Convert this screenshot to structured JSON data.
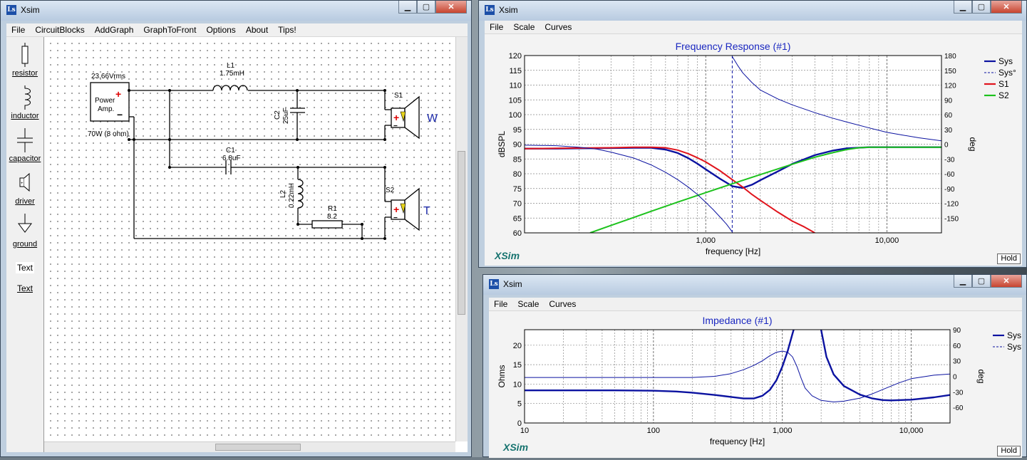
{
  "colors": {
    "sys": "#0b12a0",
    "s1": "#e0141c",
    "s2": "#1dc21d",
    "title": "#1a27c0",
    "xsim_logo": "#16736f"
  },
  "main_window": {
    "title": "Xsim",
    "menu": [
      "File",
      "CircuitBlocks",
      "AddGraph",
      "GraphToFront",
      "Options",
      "About",
      "Tips!"
    ],
    "palette": [
      {
        "label": "resistor",
        "icon": "resistor-icon"
      },
      {
        "label": "inductor",
        "icon": "inductor-icon"
      },
      {
        "label": "capacitor",
        "icon": "capacitor-icon"
      },
      {
        "label": "driver",
        "icon": "driver-icon"
      },
      {
        "label": "ground",
        "icon": "ground-icon"
      },
      {
        "label": "Text",
        "icon": "text-tool"
      },
      {
        "label": "Text",
        "icon": "text-tool"
      }
    ],
    "schematic": {
      "amp_voltage": "23.66Vrms",
      "amp_label_line1": "Power",
      "amp_label_line2": "Amp.",
      "amp_power": "70W (8 ohm)",
      "L1_name": "L1",
      "L1_value": "1.75mH",
      "C2_name": "C2",
      "C2_value": "25uF",
      "C1_name": "C1",
      "C1_value": "6.8uF",
      "L2_name": "L2",
      "L2_value": "0.22mH",
      "R1_name": "R1",
      "R1_value": "8.2",
      "S1_name": "S1",
      "S1_label": "W",
      "S2_name": "S2",
      "S2_label": "T"
    }
  },
  "freq_window": {
    "title": "Xsim",
    "menu": [
      "File",
      "Scale",
      "Curves"
    ],
    "hold": "Hold",
    "xsim_logo": "XSim"
  },
  "imp_window": {
    "title": "Xsim",
    "menu": [
      "File",
      "Scale",
      "Curves"
    ],
    "hold": "Hold",
    "xsim_logo": "XSim"
  },
  "chart_data": [
    {
      "type": "line",
      "title": "Frequency Response (#1)",
      "xlabel": "frequency [Hz]",
      "ylabel": "dBSPL",
      "y2label": "deg",
      "xscale": "log",
      "xlim": [
        100,
        20000
      ],
      "ylim": [
        60,
        120
      ],
      "y2lim": [
        -180,
        180
      ],
      "xticks": [
        {
          "v": 1000,
          "t": "1,000"
        },
        {
          "v": 10000,
          "t": "10,000"
        }
      ],
      "yticks": [
        60,
        65,
        70,
        75,
        80,
        85,
        90,
        95,
        100,
        105,
        110,
        115,
        120
      ],
      "y2ticks": [
        180,
        150,
        120,
        90,
        60,
        30,
        0,
        -30,
        -60,
        -90,
        -120,
        -150
      ],
      "grid": true,
      "legend": "top-right",
      "series": [
        {
          "name": "Sys",
          "axis": "y",
          "dash": false,
          "width": 2.4,
          "color": "#0b12a0",
          "x": [
            100,
            150,
            200,
            300,
            400,
            500,
            600,
            700,
            800,
            900,
            1000,
            1200,
            1400,
            1600,
            1800,
            2000,
            2500,
            3000,
            4000,
            5000,
            6000,
            8000,
            10000,
            12000,
            15000,
            20000
          ],
          "y": [
            88.5,
            88.5,
            88.6,
            88.7,
            88.8,
            88.8,
            88.2,
            87,
            85.3,
            83.4,
            81.5,
            78.3,
            75.8,
            75.2,
            76.3,
            77.8,
            80.8,
            83.3,
            86.3,
            87.8,
            88.6,
            89,
            89,
            89,
            89,
            89
          ]
        },
        {
          "name": "Sys°",
          "axis": "y2",
          "dash": true,
          "width": 1,
          "color": "#0b12a0",
          "x": [
            1400,
            1400
          ],
          "y": [
            -180,
            180
          ]
        },
        {
          "name": "S1",
          "axis": "y",
          "dash": false,
          "width": 2,
          "color": "#e0141c",
          "x": [
            100,
            150,
            200,
            300,
            400,
            500,
            600,
            700,
            800,
            900,
            1000,
            1200,
            1400,
            1600,
            1800,
            2000,
            2500,
            3000,
            3500,
            4000
          ],
          "y": [
            88.5,
            88.6,
            88.7,
            88.8,
            89,
            89,
            88.8,
            88,
            86.8,
            85.4,
            84,
            81,
            78,
            75.5,
            73,
            71,
            67,
            64,
            62,
            60
          ]
        },
        {
          "name": "S2",
          "axis": "y",
          "dash": false,
          "width": 2,
          "color": "#1dc21d",
          "x": [
            230,
            300,
            400,
            500,
            700,
            1000,
            1400,
            2000,
            3000,
            4000,
            5000,
            6000,
            7000,
            8000,
            10000,
            12000,
            15000,
            20000
          ],
          "y": [
            60,
            62.5,
            65.2,
            67.3,
            70.4,
            73.6,
            76.6,
            79.7,
            83.2,
            85.6,
            87.1,
            88.2,
            88.8,
            89,
            89,
            89,
            89,
            89
          ]
        },
        {
          "name": "",
          "axis": "y2",
          "dash": false,
          "width": 1,
          "color": "#0b12a0",
          "x": [
            100,
            150,
            200,
            250,
            300,
            400,
            500,
            600,
            700,
            800,
            900,
            1000,
            1100,
            1200,
            1300,
            1400
          ],
          "y": [
            -2,
            -3,
            -6,
            -10,
            -16,
            -28,
            -42,
            -57,
            -72,
            -87,
            -102,
            -118,
            -133,
            -148,
            -162,
            -178
          ]
        },
        {
          "name": "",
          "axis": "y2",
          "dash": false,
          "width": 1,
          "color": "#0b12a0",
          "x": [
            1400,
            1500,
            1600,
            1800,
            2000,
            2500,
            3000,
            4000,
            5000,
            6000,
            8000,
            10000,
            12000,
            15000,
            20000
          ],
          "y": [
            178,
            160,
            145,
            125,
            110,
            92,
            80,
            64,
            53,
            45,
            33,
            24,
            19,
            13,
            7
          ]
        }
      ]
    },
    {
      "type": "line",
      "title": "Impedance (#1)",
      "xlabel": "frequency [Hz]",
      "ylabel": "Ohms",
      "y2label": "deg",
      "xscale": "log",
      "xlim": [
        10,
        20000
      ],
      "ylim": [
        0,
        24
      ],
      "y2lim": [
        -90,
        90
      ],
      "xticks": [
        {
          "v": 10,
          "t": "10"
        },
        {
          "v": 100,
          "t": "100"
        },
        {
          "v": 1000,
          "t": "1,000"
        },
        {
          "v": 10000,
          "t": "10,000"
        }
      ],
      "yticks": [
        0,
        5,
        10,
        15,
        20
      ],
      "y2ticks": [
        90,
        60,
        30,
        0,
        -30,
        -60
      ],
      "grid": true,
      "legend": "top-right",
      "series": [
        {
          "name": "Sys",
          "axis": "y",
          "dash": false,
          "width": 2.4,
          "color": "#0b12a0",
          "x": [
            10,
            50,
            100,
            150,
            200,
            300,
            400,
            500,
            600,
            700,
            800,
            900,
            1000,
            1100,
            1200,
            1300,
            1400,
            1500,
            2000,
            2200,
            2500,
            3000,
            4000,
            5000,
            6000,
            7000,
            10000,
            15000,
            20000
          ],
          "y": [
            8.4,
            8.4,
            8.3,
            8.1,
            7.8,
            7.2,
            6.7,
            6.3,
            6.3,
            7,
            8.5,
            11,
            14.5,
            18.5,
            23,
            27,
            30,
            30,
            24,
            17,
            12.5,
            9.5,
            7.3,
            6.3,
            5.9,
            5.8,
            6,
            6.6,
            7.2
          ]
        },
        {
          "name": "Sys°",
          "axis": "y2",
          "dash": true,
          "width": 1,
          "color": "#0b12a0",
          "x": [],
          "y": []
        },
        {
          "name": "",
          "axis": "y",
          "dash": false,
          "width": 1,
          "color": "#0b12a0",
          "x": [
            10,
            50,
            100,
            200,
            300,
            400,
            500,
            600,
            700,
            800,
            900,
            1000,
            1100,
            1200,
            1300,
            1400,
            1500,
            1700,
            2000,
            2500,
            3000,
            4000,
            5000,
            6000,
            8000,
            10000,
            15000,
            20000
          ],
          "y": [
            11.7,
            11.7,
            11.7,
            11.7,
            12,
            12.7,
            13.7,
            14.8,
            16,
            17.3,
            18.2,
            18.5,
            18.2,
            17,
            14.5,
            11.5,
            9,
            7,
            5.8,
            5.4,
            5.6,
            6.4,
            7.5,
            8.6,
            10.3,
            11.4,
            12.3,
            12.6
          ]
        }
      ]
    }
  ]
}
